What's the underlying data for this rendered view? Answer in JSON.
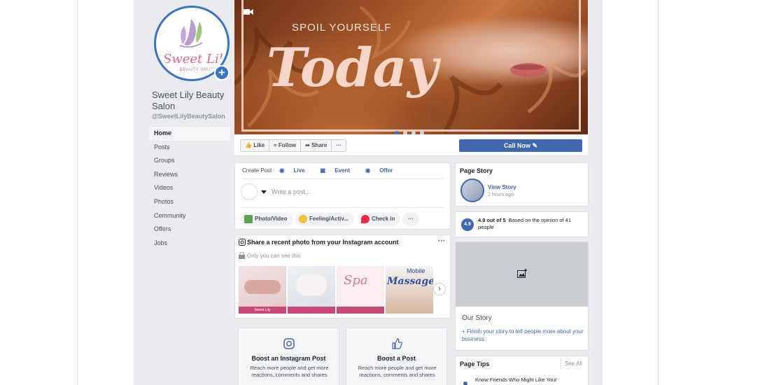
{
  "page": {
    "name": "Sweet Lily Beauty Salon",
    "handle": "@SweetLilyBeautySalon",
    "logo_word": "Sweet Lily",
    "logo_sub": "BEAUTY SALON"
  },
  "nav": [
    {
      "label": "Home",
      "active": true
    },
    {
      "label": "Posts"
    },
    {
      "label": "Groups"
    },
    {
      "label": "Reviews"
    },
    {
      "label": "Videos"
    },
    {
      "label": "Photos"
    },
    {
      "label": "Community"
    },
    {
      "label": "Offers"
    },
    {
      "label": "Jobs"
    }
  ],
  "cover": {
    "subtitle": "SPOIL YOURSELF",
    "title": "Today",
    "slides": 4,
    "active_slide": 1
  },
  "actions": {
    "like": "Like",
    "follow": "Follow",
    "share": "Share",
    "more": "···",
    "call_now": "Call Now"
  },
  "create_post": {
    "tabs": [
      "Create Post",
      "Live",
      "Event",
      "Offer"
    ],
    "placeholder": "Write a post...",
    "photo_video": "Photo/Video",
    "feeling": "Feeling/Activ...",
    "check_in": "Check in",
    "more": "···"
  },
  "instagram": {
    "title": "Share a recent photo from your Instagram account",
    "subtitle": "Only you can see this",
    "more": "···",
    "photo_texts": [
      "Sweet Lily",
      "Spa",
      "Mobile",
      "Massage"
    ]
  },
  "boost": [
    {
      "title": "Boost an Instagram Post",
      "desc": "Reach more people and get more reactions, comments and shares"
    },
    {
      "title": "Boost a Post",
      "desc": "Reach more people and get more reactions, comments and shares"
    }
  ],
  "page_story": {
    "title": "Page Story",
    "view": "View Story",
    "time": "2 hours ago"
  },
  "rating": {
    "score": "4.9",
    "summary": "4.9 out of 5",
    "detail": "Based on the opinion of 41 people"
  },
  "our_story": {
    "title": "Our Story",
    "link": "+ Finish your story to tell people more about your business."
  },
  "page_tips": {
    "title": "Page Tips",
    "see_all": "See All",
    "item": "Know Friends Who Might Like Your"
  },
  "colors": {
    "facebook_blue": "#4267b2",
    "accent_blue": "#3b72c4",
    "background": "#e9ebee"
  }
}
